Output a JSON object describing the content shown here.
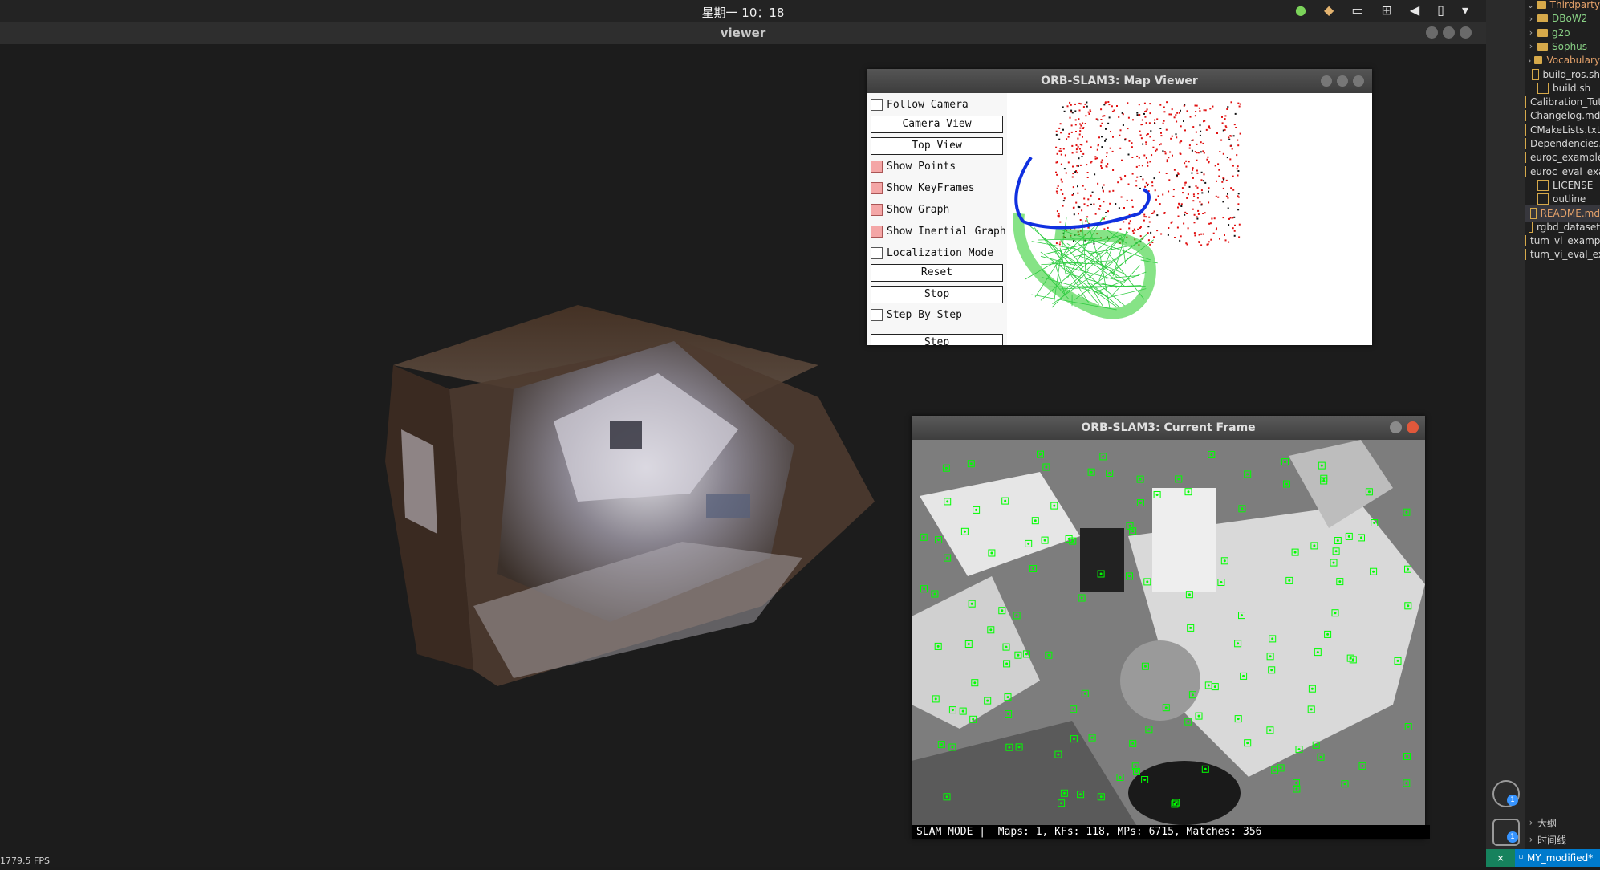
{
  "topbar": {
    "clock": "星期一 10：18",
    "tray_icons": [
      "update-check-icon",
      "cat-app-icon",
      "keyboard-icon",
      "network-icon",
      "volume-icon",
      "battery-icon",
      "menu-dropdown-icon"
    ]
  },
  "viewer": {
    "title": "viewer",
    "fps": "1779.5 FPS"
  },
  "map_viewer": {
    "title": "ORB-SLAM3: Map Viewer",
    "controls": {
      "follow_camera": "Follow Camera",
      "camera_view": "Camera View",
      "top_view": "Top View",
      "show_points": "Show Points",
      "show_keyframes": "Show KeyFrames",
      "show_graph": "Show Graph",
      "show_inertial_graph": "Show Inertial Graph",
      "localization_mode": "Localization Mode",
      "reset": "Reset",
      "stop": "Stop",
      "step_by_step": "Step By Step",
      "step": "Step"
    },
    "checked": {
      "follow_camera": false,
      "show_points": true,
      "show_keyframes": true,
      "show_graph": true,
      "show_inertial_graph": true,
      "localization_mode": false,
      "step_by_step": false
    }
  },
  "current_frame": {
    "title": "ORB-SLAM3: Current Frame",
    "status": "SLAM MODE |  Maps: 1, KFs: 118, MPs: 6715, Matches: 356"
  },
  "ide": {
    "tree": [
      {
        "label": "Thirdparty",
        "type": "folder",
        "color": "orange",
        "expanded": true
      },
      {
        "label": "DBoW2",
        "type": "folder",
        "color": "green"
      },
      {
        "label": "g2o",
        "type": "folder",
        "color": "green"
      },
      {
        "label": "Sophus",
        "type": "folder",
        "color": "green"
      },
      {
        "label": "Vocabulary",
        "type": "folder",
        "color": "orange"
      },
      {
        "label": "build_ros.sh",
        "type": "file"
      },
      {
        "label": "build.sh",
        "type": "file"
      },
      {
        "label": "Calibration_Tutorial.pdf",
        "type": "file"
      },
      {
        "label": "Changelog.md",
        "type": "file"
      },
      {
        "label": "CMakeLists.txt",
        "type": "file"
      },
      {
        "label": "Dependencies.md",
        "type": "file"
      },
      {
        "label": "euroc_examples.sh",
        "type": "file"
      },
      {
        "label": "euroc_eval_examples.sh",
        "type": "file"
      },
      {
        "label": "LICENSE",
        "type": "file"
      },
      {
        "label": "outline",
        "type": "file"
      },
      {
        "label": "README.md",
        "type": "file",
        "color": "orange",
        "selected": true
      },
      {
        "label": "rgbd_dataset",
        "type": "file"
      },
      {
        "label": "tum_vi_examples.sh",
        "type": "file"
      },
      {
        "label": "tum_vi_eval_examples.sh",
        "type": "file"
      }
    ],
    "outline_label": "大纲",
    "timeline_label": "时间线",
    "account_badge": "1",
    "settings_badge": "1",
    "branch": "MY_modified*"
  }
}
